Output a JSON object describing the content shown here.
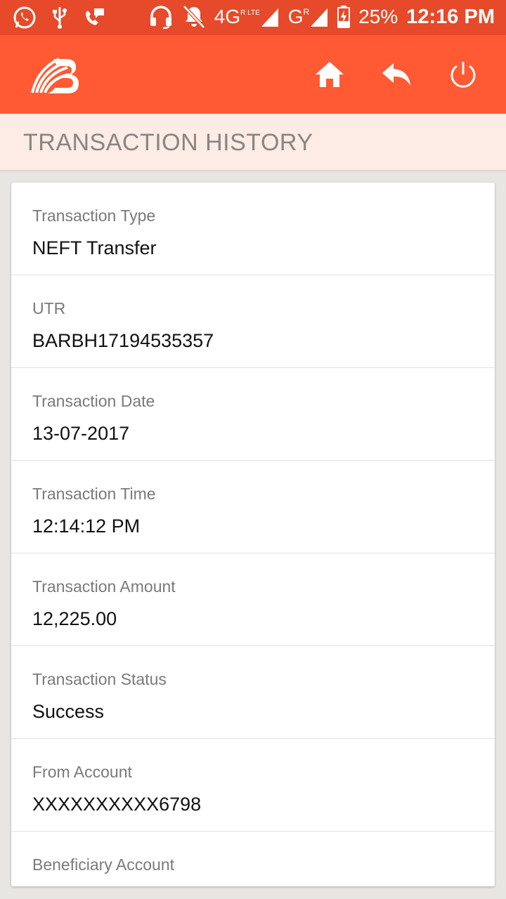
{
  "status_bar": {
    "network": "4G",
    "network_badge": "R LTE",
    "network2": "G",
    "network2_badge": "R",
    "battery": "25%",
    "time": "12:16 PM"
  },
  "app_bar": {
    "brand": "Bank of Baroda"
  },
  "page": {
    "title": "TRANSACTION HISTORY"
  },
  "details": [
    {
      "label": "Transaction Type",
      "value": "NEFT Transfer"
    },
    {
      "label": "UTR",
      "value": "BARBH17194535357"
    },
    {
      "label": "Transaction Date",
      "value": "13-07-2017"
    },
    {
      "label": "Transaction Time",
      "value": "12:14:12 PM"
    },
    {
      "label": "Transaction Amount",
      "value": "12,225.00"
    },
    {
      "label": "Transaction Status",
      "value": "Success"
    },
    {
      "label": "From Account",
      "value": "XXXXXXXXXX6798"
    },
    {
      "label": "Beneficiary Account",
      "value": ""
    }
  ],
  "colors": {
    "status_bar": "#e64a2a",
    "app_bar": "#ff5a33",
    "header_bg": "#fdebe6"
  }
}
